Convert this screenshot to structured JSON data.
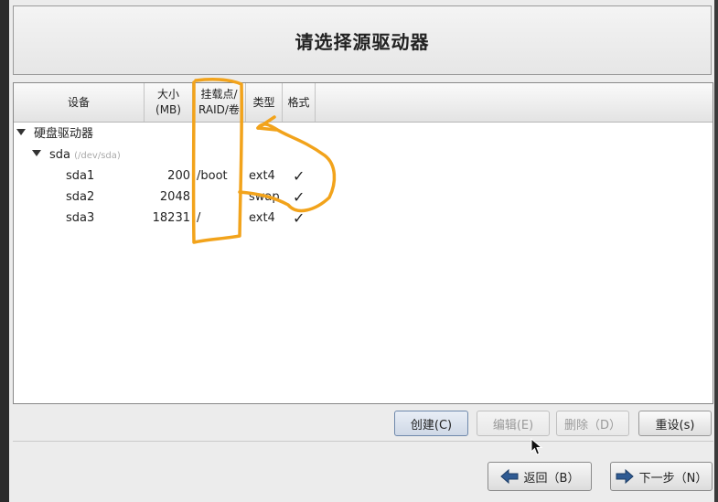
{
  "title": "请选择源驱动器",
  "columns": {
    "device": "设备",
    "size_line1": "大小",
    "size_line2": "(MB)",
    "mount_line1": "挂载点/",
    "mount_line2": "RAID/卷",
    "type": "类型",
    "format": "格式"
  },
  "tree": {
    "group_label": "硬盘驱动器",
    "disk_name": "sda",
    "disk_path": "(/dev/sda)",
    "partitions": [
      {
        "name": "sda1",
        "size": "200",
        "mount": "/boot",
        "type": "ext4",
        "format": "✓"
      },
      {
        "name": "sda2",
        "size": "2048",
        "mount": "",
        "type": "swap",
        "format": "✓"
      },
      {
        "name": "sda3",
        "size": "18231",
        "mount": "/",
        "type": "ext4",
        "format": "✓"
      }
    ]
  },
  "buttons": {
    "create": "创建(C)",
    "edit": "编辑(E)",
    "delete": "删除（D）",
    "reset": "重设(s)",
    "back": "返回（B）",
    "next": "下一步（N）"
  },
  "colors": {
    "annotation": "#f2a31b",
    "nav_arrow": "#2f5b93"
  }
}
